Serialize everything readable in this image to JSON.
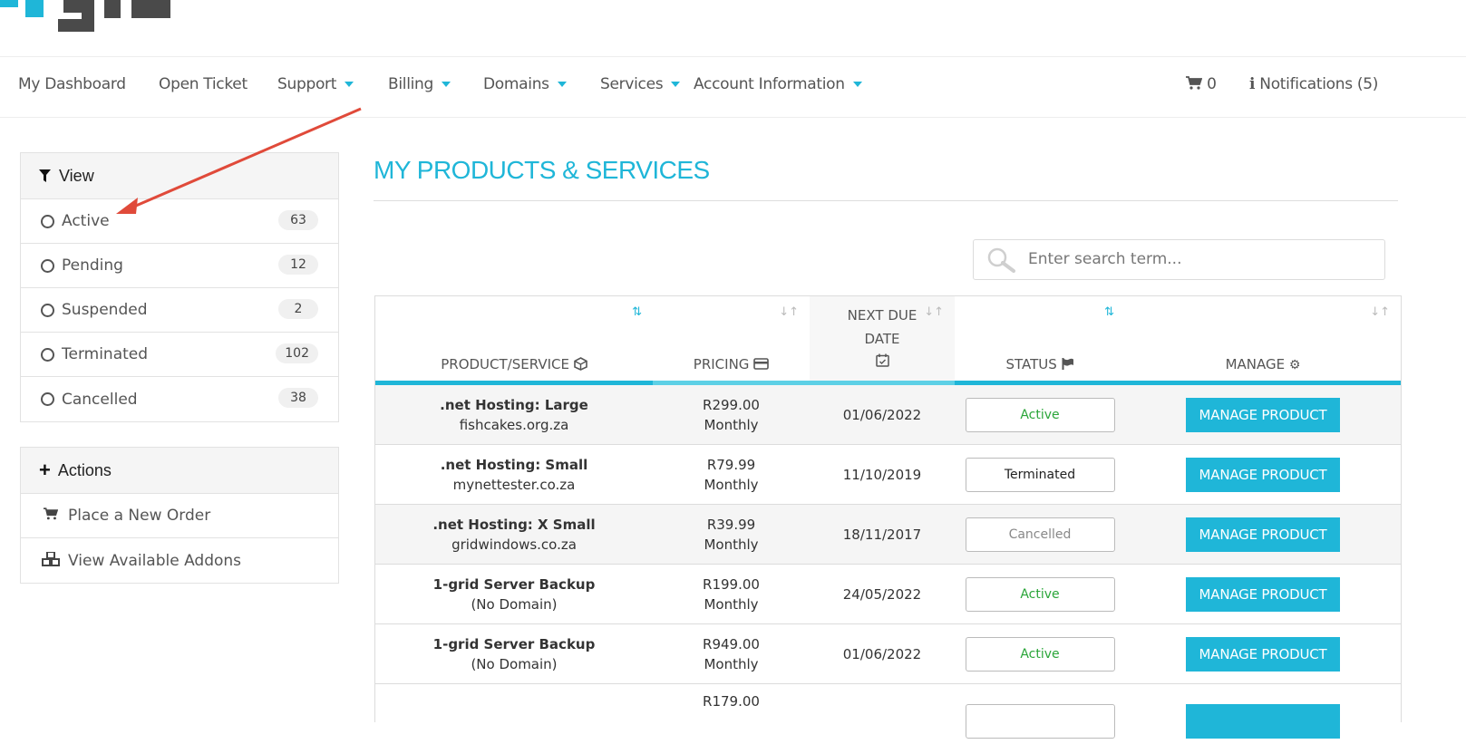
{
  "nav": {
    "items": [
      {
        "label": "My Dashboard",
        "dropdown": false
      },
      {
        "label": "Open Ticket",
        "dropdown": false
      },
      {
        "label": "Support",
        "dropdown": true
      },
      {
        "label": "Billing",
        "dropdown": true
      },
      {
        "label": "Domains",
        "dropdown": true
      },
      {
        "label": "Services",
        "dropdown": true
      },
      {
        "label": "Account Information",
        "dropdown": true
      }
    ],
    "cart_count": "0",
    "notifications_label": "Notifications (5)"
  },
  "sidebar": {
    "view_heading": "View",
    "view_items": [
      {
        "label": "Active",
        "count": "63"
      },
      {
        "label": "Pending",
        "count": "12"
      },
      {
        "label": "Suspended",
        "count": "2"
      },
      {
        "label": "Terminated",
        "count": "102"
      },
      {
        "label": "Cancelled",
        "count": "38"
      }
    ],
    "actions_heading": "Actions",
    "actions": [
      {
        "label": "Place a New Order",
        "icon": "cart-icon"
      },
      {
        "label": "View Available Addons",
        "icon": "cubes-icon"
      }
    ]
  },
  "main": {
    "title": "MY PRODUCTS & SERVICES",
    "search_placeholder": "Enter search term...",
    "columns": [
      {
        "label": "PRODUCT/SERVICE",
        "icon": "cube-icon"
      },
      {
        "label": "PRICING",
        "icon": "credit-card-icon"
      },
      {
        "label": "NEXT DUE DATE",
        "icon": "calendar-icon"
      },
      {
        "label": "STATUS",
        "icon": "flag-icon"
      },
      {
        "label": "MANAGE",
        "icon": "gears-icon"
      }
    ],
    "manage_label": "MANAGE PRODUCT",
    "rows": [
      {
        "product": ".net Hosting: Large",
        "domain": "fishcakes.org.za",
        "price": "R299.00",
        "cycle": "Monthly",
        "due": "01/06/2022",
        "status": "Active"
      },
      {
        "product": ".net Hosting: Small",
        "domain": "mynettester.co.za",
        "price": "R79.99",
        "cycle": "Monthly",
        "due": "11/10/2019",
        "status": "Terminated"
      },
      {
        "product": ".net Hosting: X Small",
        "domain": "gridwindows.co.za",
        "price": "R39.99",
        "cycle": "Monthly",
        "due": "18/11/2017",
        "status": "Cancelled"
      },
      {
        "product": "1-grid Server Backup",
        "domain": "(No Domain)",
        "price": "R199.00",
        "cycle": "Monthly",
        "due": "24/05/2022",
        "status": "Active"
      },
      {
        "product": "1-grid Server Backup",
        "domain": "(No Domain)",
        "price": "R949.00",
        "cycle": "Monthly",
        "due": "01/06/2022",
        "status": "Active"
      },
      {
        "product": "",
        "domain": "",
        "price": "R179.00",
        "cycle": "",
        "due": "",
        "status": ""
      }
    ]
  },
  "colors": {
    "accent": "#1fb6d8",
    "status_active": "#2aa539",
    "annotation_arrow": "#e04a3a"
  }
}
